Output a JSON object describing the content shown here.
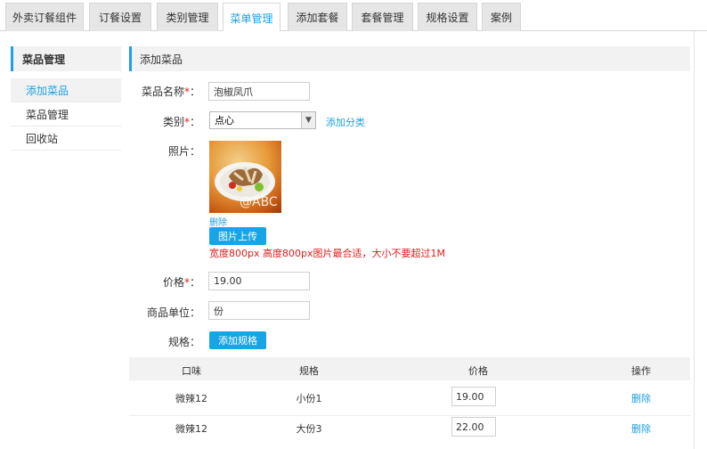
{
  "tabs": [
    {
      "label": "外卖订餐组件",
      "active": false
    },
    {
      "label": "订餐设置",
      "active": false
    },
    {
      "label": "类别管理",
      "active": false
    },
    {
      "label": "菜单管理",
      "active": true
    },
    {
      "label": "添加套餐",
      "active": false
    },
    {
      "label": "套餐管理",
      "active": false
    },
    {
      "label": "规格设置",
      "active": false
    },
    {
      "label": "案例",
      "active": false
    }
  ],
  "sidebar": {
    "title": "菜品管理",
    "items": [
      {
        "label": "添加菜品",
        "active": true
      },
      {
        "label": "菜品管理",
        "active": false
      },
      {
        "label": "回收站",
        "active": false
      }
    ]
  },
  "content": {
    "title": "添加菜品"
  },
  "form": {
    "name_label": "菜品名称",
    "name_value": "泡椒凤爪",
    "category_label": "类别",
    "category_value": "点心",
    "add_category_link": "添加分类",
    "photo_label": "照片",
    "photo_watermark": "@ABC",
    "delete_photo_link": "删除",
    "upload_button": "图片上传",
    "upload_hint": "宽度800px 高度800px图片最合适，大小不要超过1M",
    "price_label": "价格",
    "price_value": "19.00",
    "unit_label": "商品单位",
    "unit_value": "份",
    "spec_label": "规格",
    "add_spec_button": "添加规格",
    "required_mark": "*",
    "colon": "："
  },
  "spec_table": {
    "headers": [
      "口味",
      "规格",
      "价格",
      "操作"
    ],
    "rows": [
      {
        "flavor": "微辣12",
        "spec": "小份1",
        "price": "19.00",
        "action": "删除"
      },
      {
        "flavor": "微辣12",
        "spec": "大份3",
        "price": "22.00",
        "action": "删除"
      }
    ]
  },
  "colors": {
    "accent": "#1fa0e0",
    "button": "#17a5e6",
    "required": "#e01b1b"
  }
}
